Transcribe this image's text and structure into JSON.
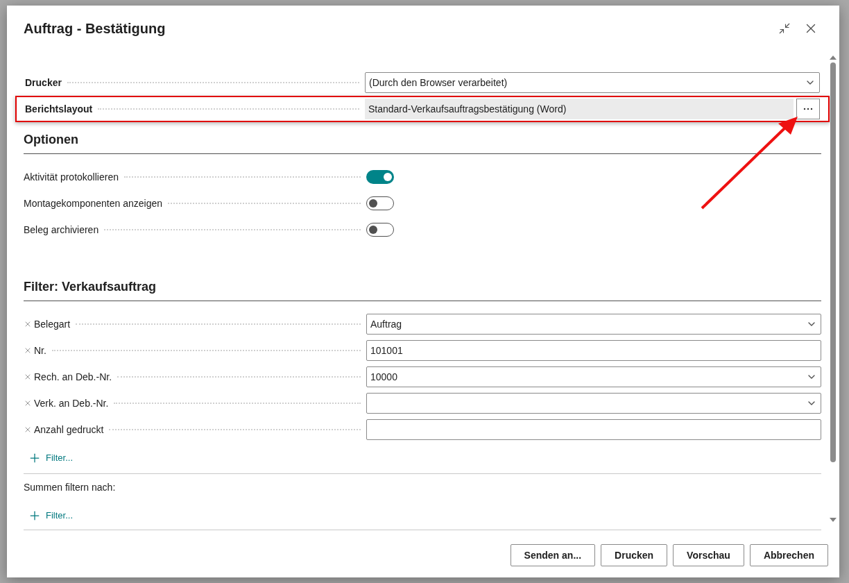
{
  "dialog": {
    "title": "Auftrag - Bestätigung",
    "settings": [
      {
        "label": "Drucker",
        "kind": "dropdown",
        "value": "(Durch den Browser verarbeitet)",
        "highlighted": false
      },
      {
        "label": "Berichtslayout",
        "kind": "lookup",
        "value": "Standard-Verkaufsauftragsbestätigung (Word)",
        "highlighted": true
      }
    ],
    "options": {
      "heading": "Optionen",
      "items": [
        {
          "label": "Aktivität protokollieren",
          "on": true
        },
        {
          "label": "Montagekomponenten anzeigen",
          "on": false
        },
        {
          "label": "Beleg archivieren",
          "on": false
        }
      ]
    },
    "filter": {
      "heading": "Filter: Verkaufsauftrag",
      "rows": [
        {
          "label": "Belegart",
          "kind": "dropdown",
          "value": "Auftrag"
        },
        {
          "label": "Nr.",
          "kind": "text",
          "value": "101001"
        },
        {
          "label": "Rech. an Deb.-Nr.",
          "kind": "dropdown",
          "value": "10000"
        },
        {
          "label": "Verk. an Deb.-Nr.",
          "kind": "dropdown"
        },
        {
          "label": "Anzahl gedruckt",
          "kind": "text"
        }
      ],
      "add_label": "Filter..."
    },
    "totals": {
      "heading": "Summen filtern nach:",
      "add_label": "Filter..."
    },
    "buttons": [
      "Senden an...",
      "Drucken",
      "Vorschau",
      "Abbrechen"
    ]
  }
}
